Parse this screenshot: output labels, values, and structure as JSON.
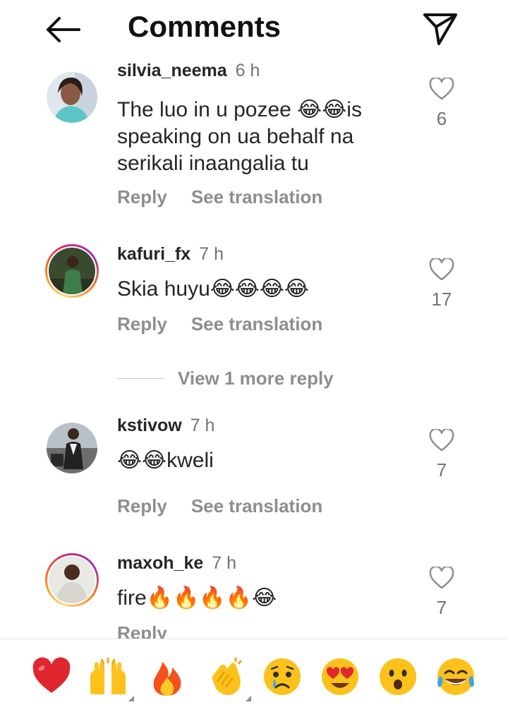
{
  "header": {
    "title": "Comments",
    "back_icon": "arrow-left-icon",
    "send_icon": "paper-plane-icon"
  },
  "comments": [
    {
      "username": "silvia_neema",
      "time": "6 h",
      "text": "The luo in u pozee 😂😂is speaking on ua behalf na serikali inaangalia tu",
      "reply_label": "Reply",
      "translate_label": "See translation",
      "likes": "6",
      "story_ring": false
    },
    {
      "username": "kafuri_fx",
      "time": "7 h",
      "text": "Skia huyu😂😂😂😂",
      "reply_label": "Reply",
      "translate_label": "See translation",
      "likes": "17",
      "story_ring": true
    },
    {
      "username": "kstivow",
      "time": "7 h",
      "text": "😂😂kweli",
      "reply_label": "Reply",
      "translate_label": "See translation",
      "likes": "7",
      "story_ring": false
    },
    {
      "username": "maxoh_ke",
      "time": "7 h",
      "text": "fire🔥🔥🔥🔥😂",
      "reply_label": "Reply",
      "likes": "7",
      "story_ring": true
    }
  ],
  "view_more_replies": "View 1 more reply",
  "emoji_bar": [
    "❤️",
    "🙌",
    "🔥",
    "👏",
    "😢",
    "😍",
    "😮",
    "😂"
  ],
  "colors": {
    "text": "#262626",
    "secondary": "#8e8e8e",
    "heart": "#ed4956",
    "emoji_yellow": "#fcc21b"
  }
}
